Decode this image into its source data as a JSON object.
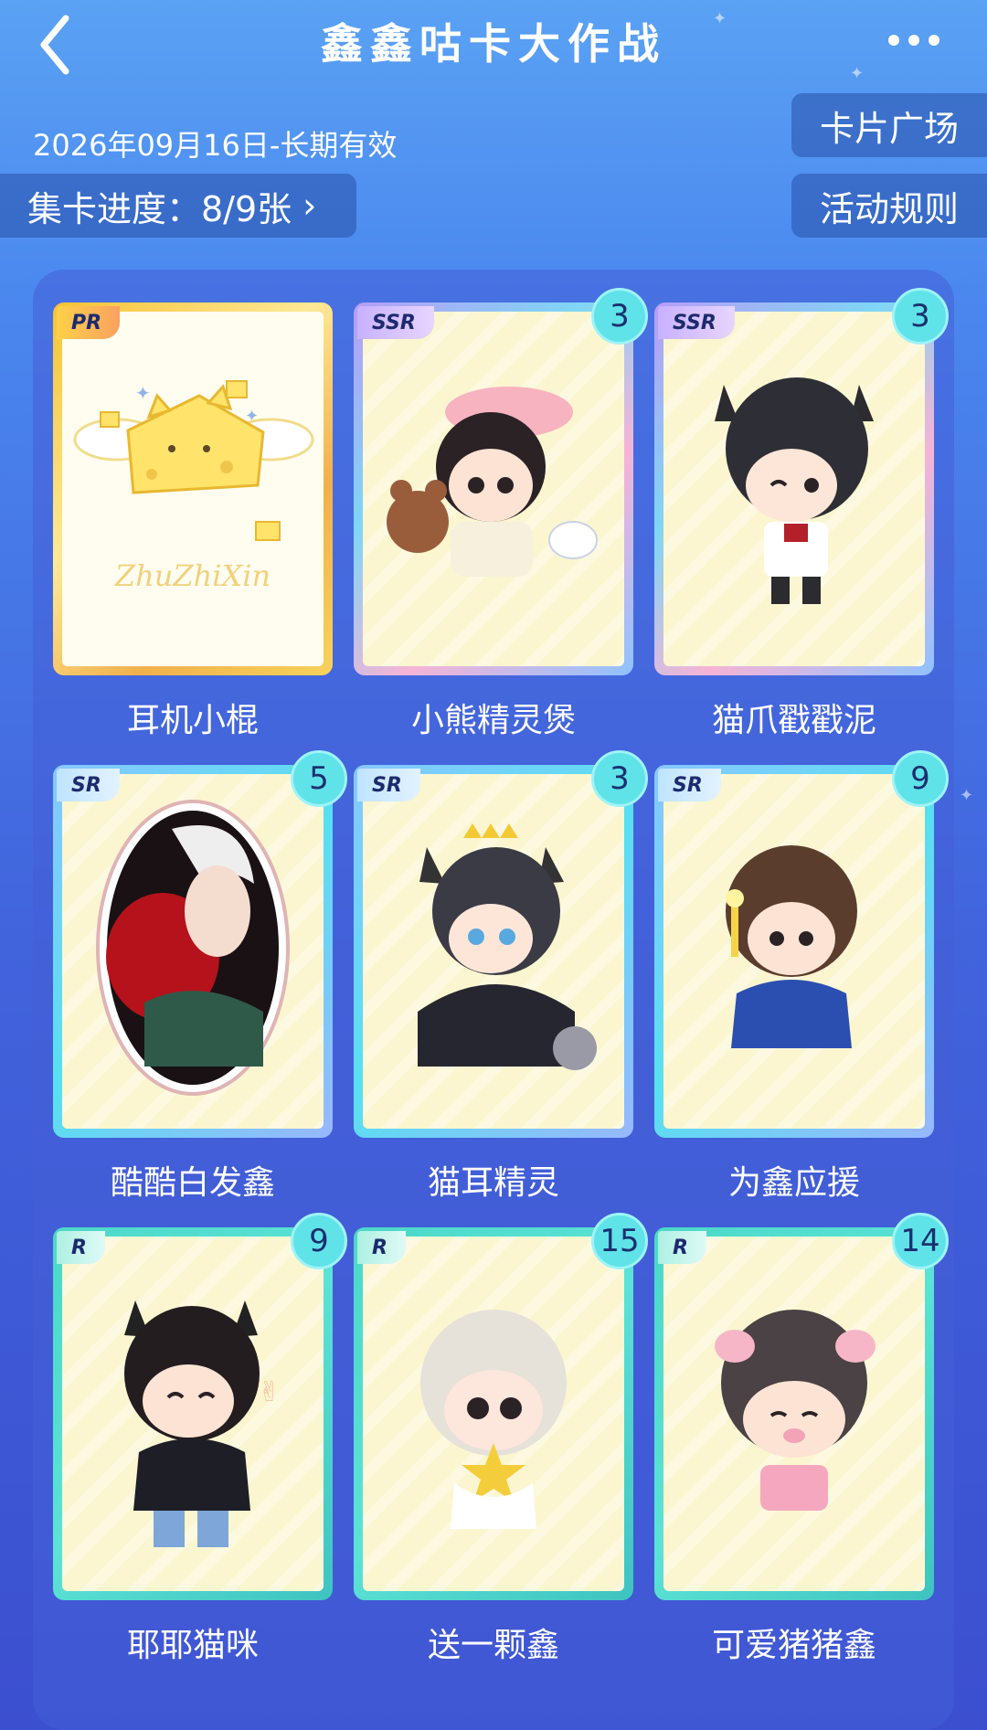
{
  "header": {
    "title": "鑫鑫咕卡大作战",
    "back_icon": "chevron-left-icon",
    "more_icon": "more-icon"
  },
  "info": {
    "date_range": "2026年09月16日-长期有效",
    "progress_label": "集卡进度：8/9张"
  },
  "side_buttons": {
    "plaza": "卡片广场",
    "rules": "活动规则"
  },
  "cards": [
    {
      "name": "耳机小棍",
      "rarity": "PR",
      "count": "",
      "art": "cheese-cat-zhuzhixin"
    },
    {
      "name": "小熊精灵煲",
      "rarity": "SSR",
      "count": "3",
      "art": "chibi-bear-sleepy"
    },
    {
      "name": "猫爪戳戳泥",
      "rarity": "SSR",
      "count": "3",
      "art": "chibi-cat-ears-paw"
    },
    {
      "name": "酷酷白发鑫",
      "rarity": "SR",
      "count": "5",
      "art": "white-hair-portrait"
    },
    {
      "name": "猫耳精灵",
      "rarity": "SR",
      "count": "3",
      "art": "chibi-cat-ears-crown"
    },
    {
      "name": "为鑫应援",
      "rarity": "SR",
      "count": "9",
      "art": "chibi-cheer-lightstick"
    },
    {
      "name": "耶耶猫咪",
      "rarity": "R",
      "count": "9",
      "art": "chibi-peace-sign-cat"
    },
    {
      "name": "送一颗鑫",
      "rarity": "R",
      "count": "15",
      "art": "chibi-holding-star"
    },
    {
      "name": "可爱猪猪鑫",
      "rarity": "R",
      "count": "14",
      "art": "chibi-pig-ears"
    }
  ],
  "decor": {
    "cheese_signature": "ZhuZhiXin"
  },
  "colors": {
    "background_top": "#5aa2f4",
    "background_bottom": "#3b4fcf",
    "card_inner": "#fbf6d0",
    "count_badge": "#5fe3e8"
  }
}
